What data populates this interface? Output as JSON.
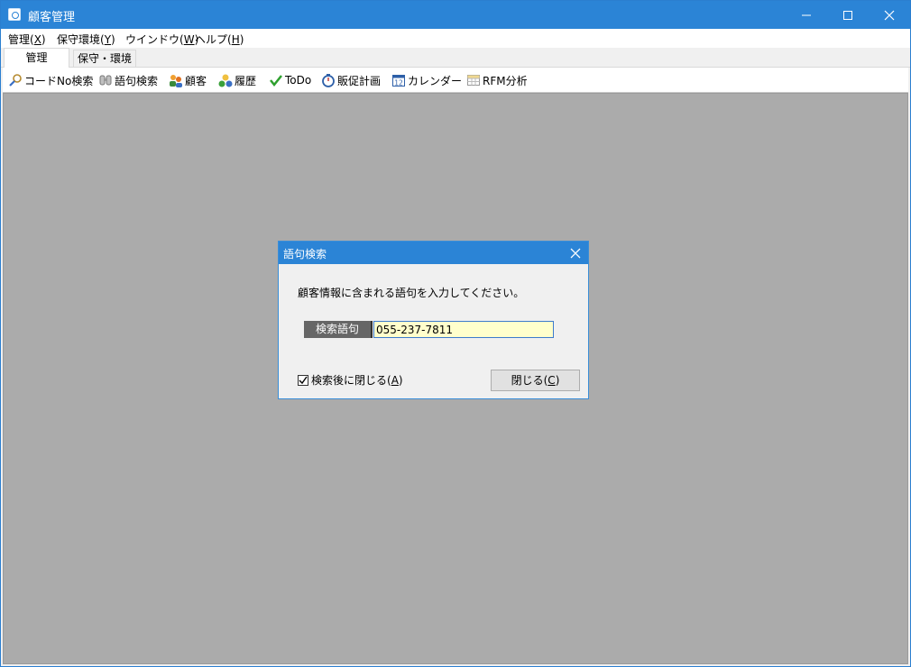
{
  "window": {
    "title": "顧客管理"
  },
  "menu": [
    {
      "label": "管理(",
      "key": "X",
      "tail": ")"
    },
    {
      "label": "保守環境(",
      "key": "Y",
      "tail": ")"
    },
    {
      "label": "ウインドウ(",
      "key": "W",
      "tail": ")"
    },
    {
      "label": "ヘルプ(",
      "key": "H",
      "tail": ")"
    }
  ],
  "tabs": {
    "active": "管理",
    "inactive": "保守・環境"
  },
  "toolbar": [
    {
      "label": "コードNo検索",
      "icon": "magnifier-icon"
    },
    {
      "label": "語句検索",
      "icon": "binoculars-icon"
    },
    {
      "label": "顧客",
      "icon": "customers-icon"
    },
    {
      "label": "履歴",
      "icon": "history-icon"
    },
    {
      "label": "ToDo",
      "icon": "checkmark-icon"
    },
    {
      "label": "販促計画",
      "icon": "stopwatch-icon"
    },
    {
      "label": "カレンダー",
      "icon": "calendar-icon"
    },
    {
      "label": "RFM分析",
      "icon": "grid-icon"
    }
  ],
  "calendar_icon_number": "12",
  "dialog": {
    "title": "語句検索",
    "message": "顧客情報に含まれる語句を入力してください。",
    "field_label": "検索語句",
    "field_value": "055-237-7811",
    "checkbox_label": "検索後に閉じる(",
    "checkbox_key": "A",
    "checkbox_tail": ")",
    "checkbox_checked": true,
    "close_label": "閉じる(",
    "close_key": "C",
    "close_tail": ")"
  },
  "colors": {
    "titlebar": "#2b84d6",
    "workspace": "#ababab",
    "input_bg": "#ffffcc"
  }
}
